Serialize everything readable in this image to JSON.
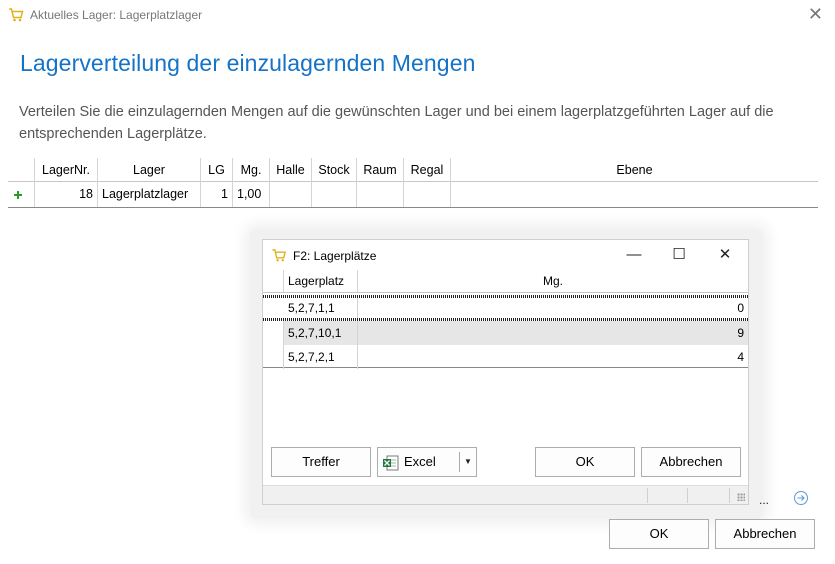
{
  "window": {
    "title": "Aktuelles Lager: Lagerplatzlager",
    "close_glyph": "✕",
    "icon": "cart-icon"
  },
  "heading": "Lagerverteilung der einzulagernden Mengen",
  "description": "Verteilen Sie die einzulagernden Mengen auf die gewünschten Lager und bei einem lagerplatzgeführten Lager auf die entsprechenden Lagerplätze.",
  "main_grid": {
    "columns": [
      "LagerNr.",
      "Lager",
      "LG",
      "Mg.",
      "Halle",
      "Stock",
      "Raum",
      "Regal",
      "Ebene"
    ],
    "rows": [
      {
        "lagernr": "18",
        "lager": "Lagerplatzlager",
        "lg": "1",
        "mg": "1,00",
        "halle": "",
        "stock": "",
        "raum": "",
        "regal": "",
        "ebene": ""
      }
    ]
  },
  "dialog": {
    "title": "F2: Lagerplätze",
    "minimize_glyph": "—",
    "maximize_glyph": "☐",
    "close_glyph": "✕",
    "columns": [
      "Lagerplatz",
      "Mg."
    ],
    "rows": [
      {
        "platz": "5,2,7,1,1",
        "mg": "0"
      },
      {
        "platz": "5,2,7,10,1",
        "mg": "9"
      },
      {
        "platz": "5,2,7,2,1",
        "mg": "4"
      }
    ],
    "buttons": {
      "treffer": "Treffer",
      "excel": "Excel",
      "excel_arrow": "▼",
      "ok": "OK",
      "cancel": "Abbrechen"
    }
  },
  "footer": {
    "ellipsis": "...",
    "ok": "OK",
    "cancel": "Abbrechen"
  },
  "colors": {
    "heading": "#1473c6",
    "plus": "#2a9a2a",
    "cart": "#e2b21c",
    "excel": "#1f7a3e"
  }
}
